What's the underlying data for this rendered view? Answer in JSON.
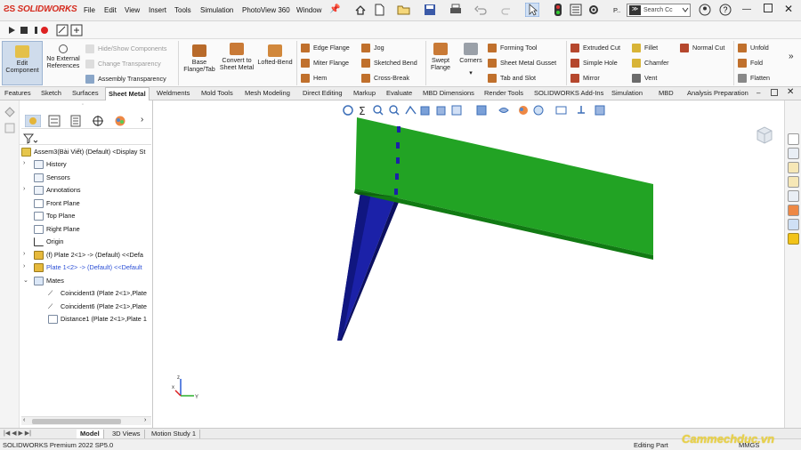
{
  "app": {
    "brand": "SOLIDWORKS"
  },
  "menu": [
    "File",
    "Edit",
    "View",
    "Insert",
    "Tools",
    "Simulation",
    "PhotoView 360",
    "Window"
  ],
  "toolbar": {
    "search_placeholder": "Search Cc",
    "profile_label": "P.."
  },
  "command_manager": {
    "edit_component": "Edit Component",
    "no_external_references": "No External References",
    "hide_show_components": "Hide/Show Components",
    "change_transparency": "Change Transparency",
    "assembly_transparency": "Assembly Transparency",
    "base_flange": "Base Flange/Tab",
    "convert_to_sheet_metal": "Convert to Sheet Metal",
    "lofted_bend": "Lofted-Bend",
    "edge_flange": "Edge Flange",
    "miter_flange": "Miter Flange",
    "hem": "Hem",
    "jog": "Jog",
    "sketched_bend": "Sketched Bend",
    "cross_break": "Cross-Break",
    "swept_flange": "Swept Flange",
    "corners": "Corners",
    "forming_tool": "Forming Tool",
    "sheet_metal_gusset": "Sheet Metal Gusset",
    "tab_and_slot": "Tab and Slot",
    "extruded_cut": "Extruded Cut",
    "simple_hole": "Simple Hole",
    "mirror": "Mirror",
    "fillet": "Fillet",
    "chamfer": "Chamfer",
    "vent": "Vent",
    "normal_cut": "Normal Cut",
    "unfold": "Unfold",
    "fold": "Fold",
    "flatten": "Flatten"
  },
  "tabs": [
    "Features",
    "Sketch",
    "Surfaces",
    "Sheet Metal",
    "Weldments",
    "Mold Tools",
    "Mesh Modeling",
    "Direct Editing",
    "Markup",
    "Evaluate",
    "MBD Dimensions",
    "Render Tools",
    "SOLIDWORKS Add-Ins",
    "Simulation",
    "MBD",
    "Analysis Preparation"
  ],
  "active_tab": "Sheet Metal",
  "tree": {
    "root": "Assem3(Bài Viết) (Default) <Display St",
    "items": {
      "history": "History",
      "sensors": "Sensors",
      "annotations": "Annotations",
      "front_plane": "Front Plane",
      "top_plane": "Top Plane",
      "right_plane": "Right Plane",
      "origin": "Origin",
      "plate2": "(f) Plate 2<1> -> (Default) <<Defa",
      "plate1": "Plate 1<2> -> (Default) <<Default",
      "mates": "Mates",
      "coincident3": "Coincident3 (Plate 2<1>,Plate",
      "coincident6": "Coincident6 (Plate 2<1>,Plate",
      "distance1": "Distance1 (Plate 2<1>,Plate 1"
    }
  },
  "bottom_tabs": [
    "Model",
    "3D Views",
    "Motion Study 1"
  ],
  "status": {
    "product": "SOLIDWORKS Premium 2022 SP5.0",
    "mode": "Editing Part",
    "units": "MMGS"
  },
  "watermark": "Cammechduc.vn",
  "colors": {
    "green_plate": "#22a324",
    "blue_plate": "#1b21a8",
    "brand_red": "#d52b1e"
  },
  "triad_labels": {
    "x": "x",
    "y": "Y",
    "z": "z"
  }
}
